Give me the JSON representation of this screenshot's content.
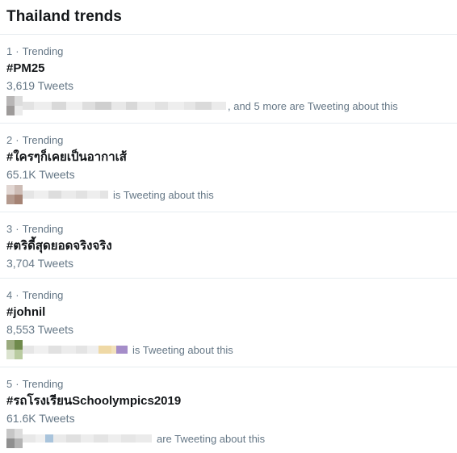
{
  "header": {
    "title": "Thailand trends"
  },
  "trends": [
    {
      "rank": "1",
      "separator": "·",
      "category": "Trending",
      "tag": "#PM25",
      "count": "3,619 Tweets",
      "social": ", and 5 more are Tweeting about this"
    },
    {
      "rank": "2",
      "separator": "·",
      "category": "Trending",
      "tag": "#ใครๆก็เคยเป็นอากาเส้",
      "count": "65.1K Tweets",
      "social": "is Tweeting about this"
    },
    {
      "rank": "3",
      "separator": "·",
      "category": "Trending",
      "tag": "#ตริดี้สุดยอดจริงจริง",
      "count": "3,704 Tweets"
    },
    {
      "rank": "4",
      "separator": "·",
      "category": "Trending",
      "tag": "#johnil",
      "count": "8,553 Tweets",
      "social": "is Tweeting about this"
    },
    {
      "rank": "5",
      "separator": "·",
      "category": "Trending",
      "tag": "#รถโรงเรียนSchoolympics2019",
      "count": "61.6K Tweets",
      "social": "are Tweeting about this"
    }
  ],
  "colors": {
    "text_primary": "#14171a",
    "text_secondary": "#657786",
    "divider": "#e6ecf0",
    "blur_gray": "#d4d7da"
  }
}
